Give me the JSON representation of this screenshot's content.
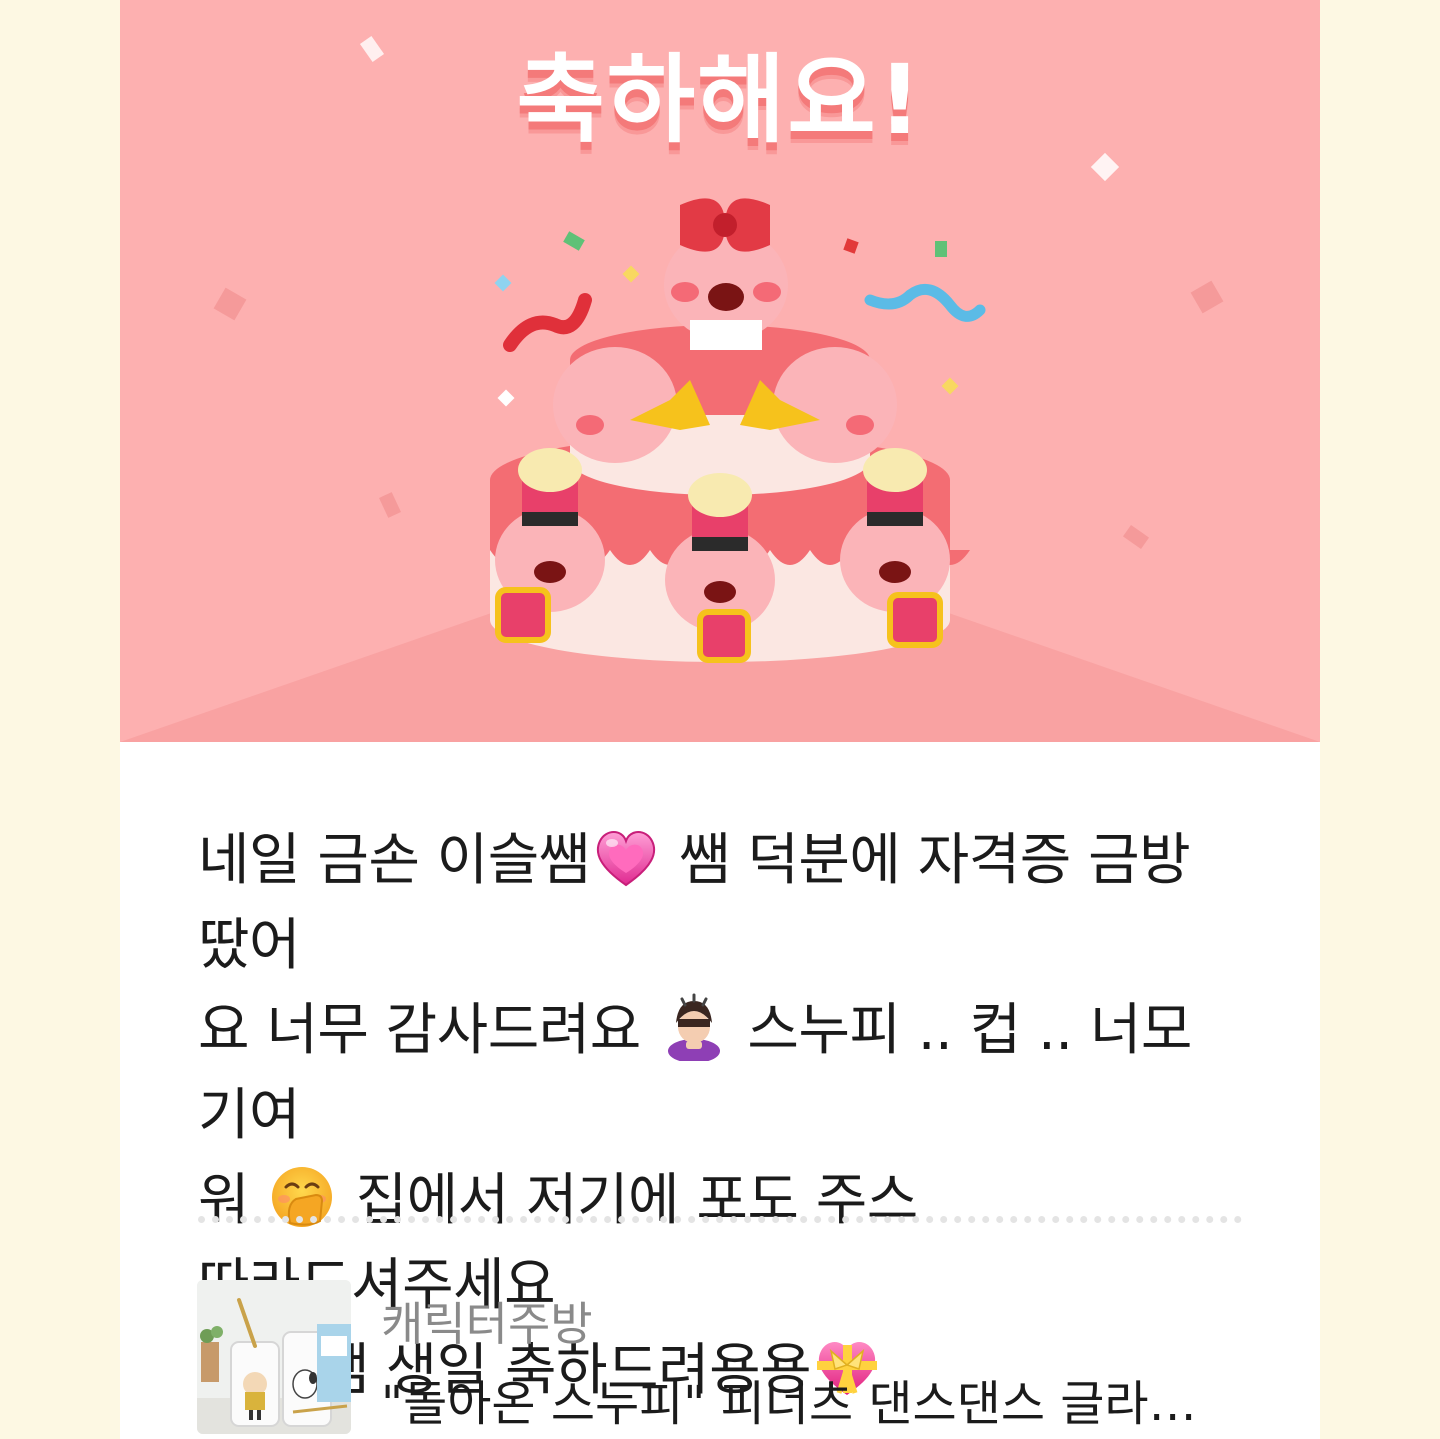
{
  "banner": {
    "title": "축하해요!",
    "illustration": "birthday-cake-character-illustration",
    "colors": {
      "background": "#fdb0b0",
      "title_shadow": "#f47a7a",
      "cake": "#f36d73"
    }
  },
  "message": {
    "lines": [
      {
        "text": "네일 금손 이슬쌤",
        "emoji": "growing-heart-emoji",
        "after": " 쌤 덕분에 자격증 금방 땄어"
      },
      {
        "text": "요 너무 감사드려요 ",
        "emoji": "person-bowing-emoji",
        "after": " 스누피 .. 컵 .. 너모 기여"
      },
      {
        "text": "워 ",
        "emoji": "hand-over-mouth-emoji",
        "after": " 집에서 저기에 포도 주스 따라드셔주세요"
      },
      {
        "text": "히히 쌤 생일 축하드려용용",
        "emoji": "heart-with-ribbon-emoji",
        "after": ""
      }
    ]
  },
  "product": {
    "brand": "캐릭터주방",
    "title": "\"돌아온 스누피\" 피너츠 댄스댄스 글라…",
    "thumbnail_icon": "snoopy-glass-product-thumbnail"
  }
}
